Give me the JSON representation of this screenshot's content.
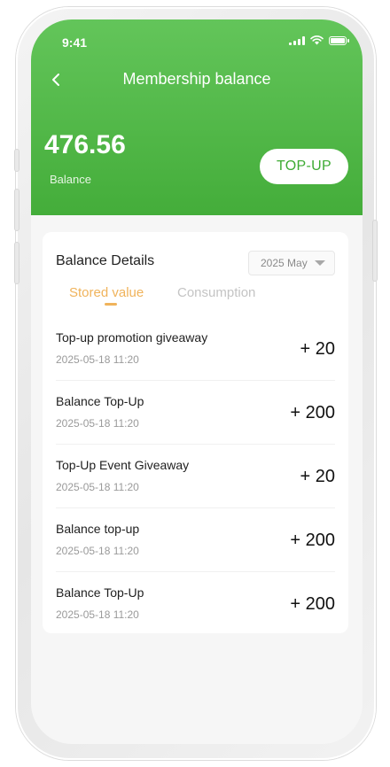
{
  "status_bar": {
    "time": "9:41"
  },
  "header": {
    "title": "Membership balance",
    "balance_value": "476.56",
    "balance_label": "Balance",
    "topup_label": "TOP-UP"
  },
  "details": {
    "title": "Balance Details",
    "date_filter": "2025 May",
    "tabs": [
      {
        "label": "Stored value",
        "active": true
      },
      {
        "label": "Consumption",
        "active": false
      }
    ],
    "records": [
      {
        "title": "Top-up promotion giveaway",
        "date": "2025-05-18 11:20",
        "amount": "+ 20"
      },
      {
        "title": "Balance Top-Up",
        "date": "2025-05-18 11:20",
        "amount": "+ 200"
      },
      {
        "title": "Top-Up Event Giveaway",
        "date": "2025-05-18 11:20",
        "amount": "+ 20"
      },
      {
        "title": "Balance top-up",
        "date": "2025-05-18 11:20",
        "amount": "+ 200"
      },
      {
        "title": "Balance Top-Up",
        "date": "2025-05-18 11:20",
        "amount": "+ 200"
      }
    ]
  },
  "colors": {
    "header_green": "#4cb443",
    "accent_orange": "#f0b35b",
    "topup_text": "#3dab33"
  },
  "icons": [
    "chevron-left-icon",
    "signal-icon",
    "wifi-icon",
    "battery-icon",
    "caret-down-icon"
  ]
}
